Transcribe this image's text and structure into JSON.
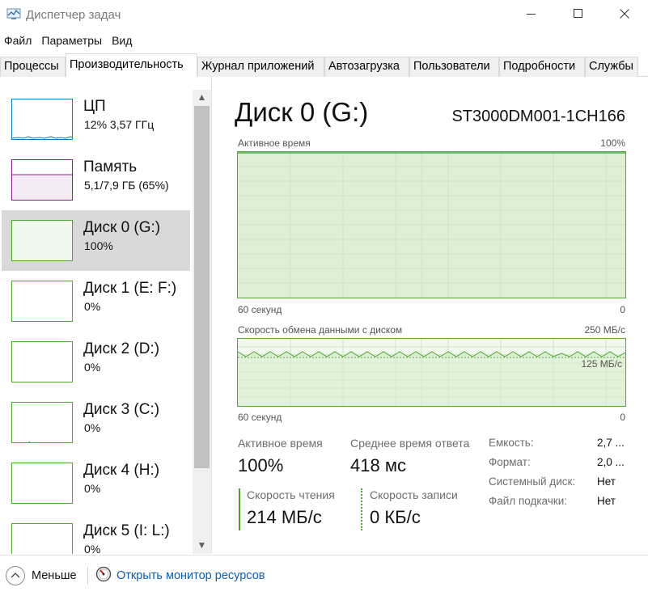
{
  "window": {
    "title": "Диспетчер задач",
    "icons": {
      "app": "task-manager-icon",
      "minimize": "minimize-icon",
      "maximize": "maximize-icon",
      "close": "close-icon"
    }
  },
  "menu": [
    "Файл",
    "Параметры",
    "Вид"
  ],
  "tabs": [
    "Процессы",
    "Производительность",
    "Журнал приложений",
    "Автозагрузка",
    "Пользователи",
    "Подробности",
    "Службы"
  ],
  "active_tab": "Производительность",
  "sidebar": {
    "items": [
      {
        "name": "ЦП",
        "value": "12% 3,57 ГГц",
        "selected": false
      },
      {
        "name": "Память",
        "value": "5,1/7,9 ГБ (65%)",
        "selected": false
      },
      {
        "name": "Диск 0 (G:)",
        "value": "100%",
        "selected": true
      },
      {
        "name": "Диск 1 (E: F:)",
        "value": "0%",
        "selected": false
      },
      {
        "name": "Диск 2 (D:)",
        "value": "0%",
        "selected": false
      },
      {
        "name": "Диск 3 (C:)",
        "value": "0%",
        "selected": false
      },
      {
        "name": "Диск 4 (H:)",
        "value": "0%",
        "selected": false
      },
      {
        "name": "Диск 5 (I: L:)",
        "value": "0%",
        "selected": false
      }
    ]
  },
  "detail": {
    "title": "Диск 0 (G:)",
    "model": "ST3000DM001-1CH166",
    "graph1": {
      "label": "Активное время",
      "max": "100%",
      "time": "60 секунд",
      "min": "0",
      "value_percent": 100
    },
    "graph2": {
      "label": "Скорость обмена данными с диском",
      "max": "250 МБ/с",
      "mid": "125 МБ/с",
      "time": "60 секунд",
      "min": "0"
    },
    "stats": {
      "active_time_label": "Активное время",
      "active_time_value": "100%",
      "response_label": "Среднее время ответа",
      "response_value": "418 мс",
      "read_label": "Скорость чтения",
      "read_value": "214 МБ/с",
      "write_label": "Скорость записи",
      "write_value": "0 КБ/с"
    },
    "info": [
      {
        "label": "Емкость:",
        "value": "2,7 ..."
      },
      {
        "label": "Формат:",
        "value": "2,0 ..."
      },
      {
        "label": "Системный диск:",
        "value": "Нет"
      },
      {
        "label": "Файл подкачки:",
        "value": "Нет"
      }
    ]
  },
  "footer": {
    "less": "Меньше",
    "resource_monitor": "Открыть монитор ресурсов"
  },
  "colors": {
    "disk_accent": "#4daa2f",
    "cpu_accent": "#0f7dbd",
    "memory_accent": "#8b1f8e",
    "link": "#0b5fb8"
  }
}
